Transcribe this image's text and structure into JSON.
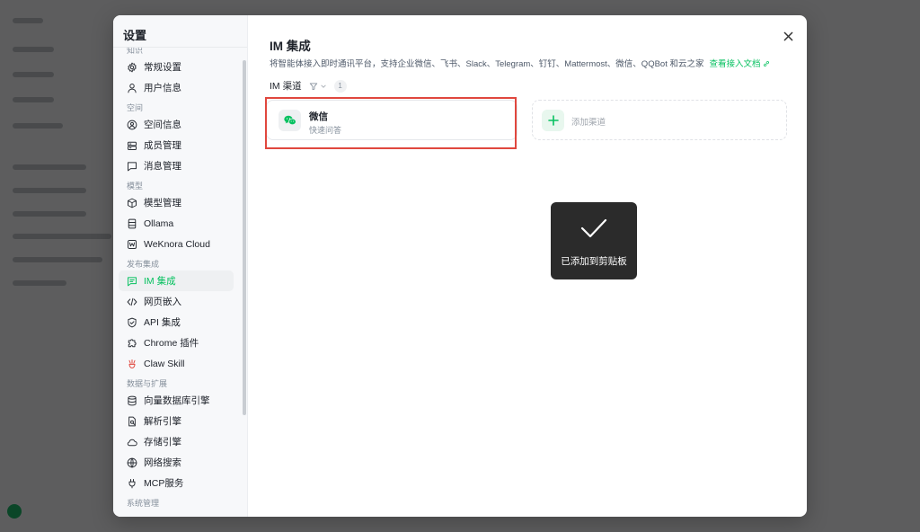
{
  "settings": {
    "title": "设置",
    "sections": [
      {
        "label": "知识",
        "items": [
          {
            "label": "常规设置",
            "icon": "gear-icon"
          },
          {
            "label": "用户信息",
            "icon": "user-icon"
          }
        ]
      },
      {
        "label": "空间",
        "items": [
          {
            "label": "空间信息",
            "icon": "space-icon"
          },
          {
            "label": "成员管理",
            "icon": "members-icon"
          },
          {
            "label": "消息管理",
            "icon": "message-icon"
          }
        ]
      },
      {
        "label": "模型",
        "items": [
          {
            "label": "模型管理",
            "icon": "cube-icon"
          },
          {
            "label": "Ollama",
            "icon": "ollama-icon"
          },
          {
            "label": "WeKnora Cloud",
            "icon": "cloud-w-icon"
          }
        ]
      },
      {
        "label": "发布集成",
        "items": [
          {
            "label": "IM 集成",
            "icon": "chat-icon",
            "active": true
          },
          {
            "label": "网页嵌入",
            "icon": "code-icon"
          },
          {
            "label": "API 集成",
            "icon": "shield-icon"
          },
          {
            "label": "Chrome 插件",
            "icon": "puzzle-icon"
          },
          {
            "label": "Claw Skill",
            "icon": "claw-icon"
          }
        ]
      },
      {
        "label": "数据与扩展",
        "items": [
          {
            "label": "向量数据库引擎",
            "icon": "database-icon"
          },
          {
            "label": "解析引擎",
            "icon": "file-search-icon"
          },
          {
            "label": "存储引擎",
            "icon": "cloud-icon"
          },
          {
            "label": "网络搜索",
            "icon": "globe-icon"
          },
          {
            "label": "MCP服务",
            "icon": "plug-icon"
          }
        ]
      },
      {
        "label": "系统管理",
        "items": []
      }
    ]
  },
  "main": {
    "title": "IM 集成",
    "description": "将智能体接入即时通讯平台，支持企业微信、飞书、Slack、Telegram、钉钉、Mattermost、微信、QQBot 和云之家",
    "doc_link": "查看接入文档",
    "channels_label": "IM 渠道",
    "channel_count": "1",
    "channels": [
      {
        "name": "微信",
        "subtitle": "快速问答",
        "icon": "wechat-icon"
      }
    ],
    "add_channel_label": "添加渠道"
  },
  "toast": {
    "text": "已添加到剪贴板",
    "icon": "check-icon"
  },
  "colors": {
    "accent": "#07c160",
    "highlight": "#e0473e",
    "toast_bg": "#2b2b2b"
  }
}
